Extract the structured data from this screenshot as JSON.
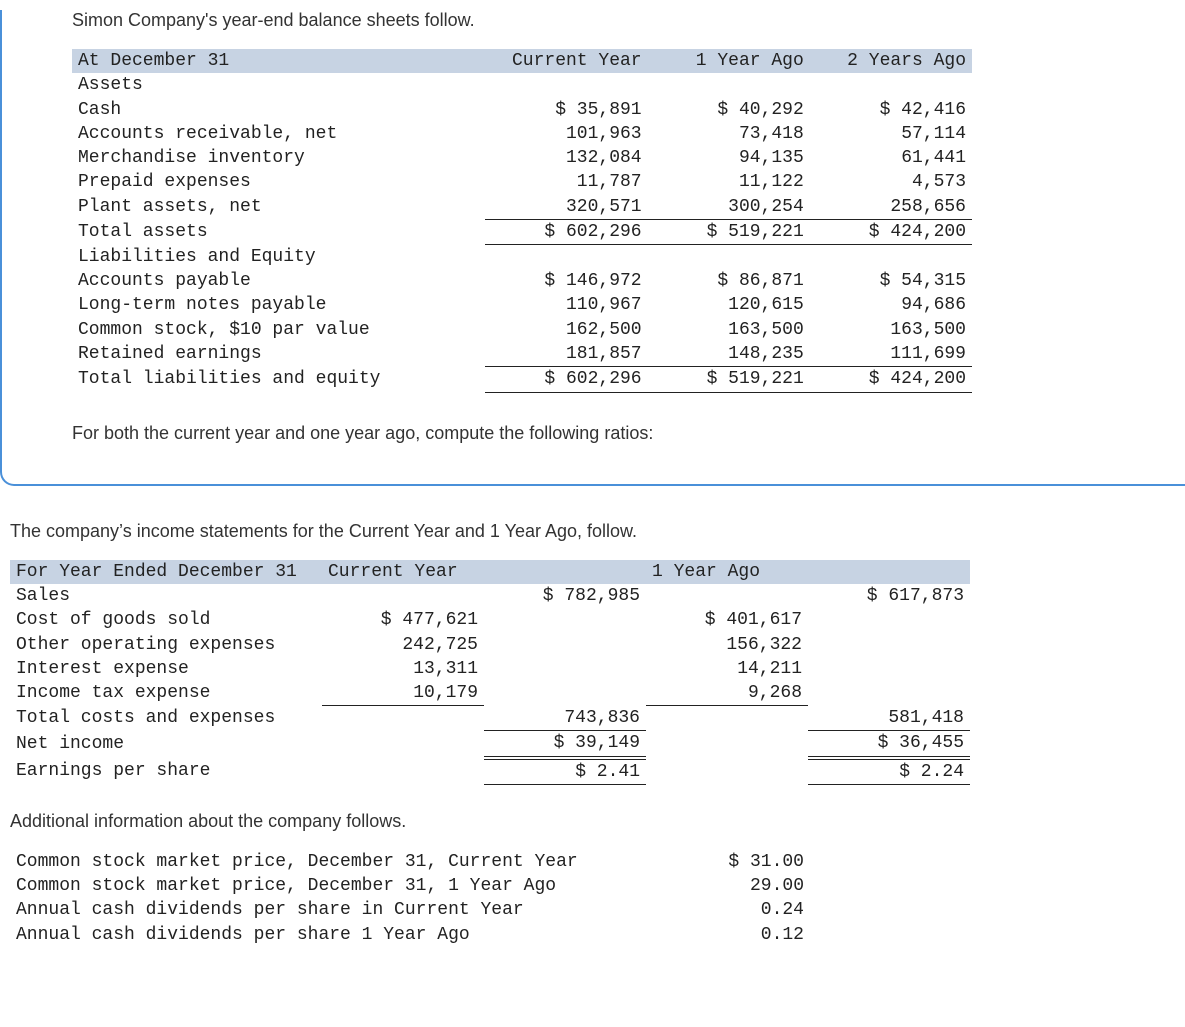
{
  "intro1": "Simon Company's year-end balance sheets follow.",
  "bs": {
    "header": {
      "h0": "At December 31",
      "h1": "Current Year",
      "h2": "1 Year Ago",
      "h3": "2 Years Ago"
    },
    "assets_header": "Assets",
    "rows": {
      "cash": {
        "label": "Cash",
        "c": "$ 35,891",
        "y1": "$ 40,292",
        "y2": "$ 42,416"
      },
      "ar": {
        "label": "Accounts receivable, net",
        "c": "101,963",
        "y1": "73,418",
        "y2": "57,114"
      },
      "inv": {
        "label": "Merchandise inventory",
        "c": "132,084",
        "y1": "94,135",
        "y2": "61,441"
      },
      "prepaid": {
        "label": "Prepaid expenses",
        "c": "11,787",
        "y1": "11,122",
        "y2": "4,573"
      },
      "plant": {
        "label": "Plant assets, net",
        "c": "320,571",
        "y1": "300,254",
        "y2": "258,656"
      },
      "tassets": {
        "label": "Total assets",
        "c": "$ 602,296",
        "y1": "$ 519,221",
        "y2": "$ 424,200"
      }
    },
    "liab_header": "Liabilities and Equity",
    "lrows": {
      "ap": {
        "label": "Accounts payable",
        "c": "$ 146,972",
        "y1": "$ 86,871",
        "y2": "$ 54,315"
      },
      "ltnp": {
        "label": "Long-term notes payable",
        "c": "110,967",
        "y1": "120,615",
        "y2": "94,686"
      },
      "cs": {
        "label": "Common stock, $10 par value",
        "c": "162,500",
        "y1": "163,500",
        "y2": "163,500"
      },
      "re": {
        "label": "Retained earnings",
        "c": "181,857",
        "y1": "148,235",
        "y2": "111,699"
      },
      "tle": {
        "label": "Total liabilities and equity",
        "c": "$ 602,296",
        "y1": "$ 519,221",
        "y2": "$ 424,200"
      }
    }
  },
  "followup1": "For both the current year and one year ago, compute the following ratios:",
  "intro2": "The company’s income statements for the Current Year and 1 Year Ago, follow.",
  "is": {
    "header": {
      "h0": "For Year Ended December 31",
      "h1": "Current Year",
      "h2": "1 Year Ago"
    },
    "rows": {
      "sales": {
        "label": "Sales",
        "c": "$ 782,985",
        "y1": "$ 617,873"
      },
      "cogs": {
        "label": "Cost of goods sold",
        "dc": "$ 477,621",
        "dy1": "$ 401,617"
      },
      "ooe": {
        "label": "Other operating expenses",
        "dc": "242,725",
        "dy1": "156,322"
      },
      "int": {
        "label": "Interest expense",
        "dc": "13,311",
        "dy1": "14,211"
      },
      "tax": {
        "label": "Income tax expense",
        "dc": "10,179",
        "dy1": "9,268"
      },
      "tce": {
        "label": "Total costs and expenses",
        "c": "743,836",
        "y1": "581,418"
      },
      "ni": {
        "label": "Net income",
        "c": "$ 39,149",
        "y1": "$ 36,455"
      },
      "eps": {
        "label": "Earnings per share",
        "c": "$ 2.41",
        "y1": "$ 2.24"
      }
    }
  },
  "intro3": "Additional information about the company follows.",
  "info": {
    "r1": {
      "label": "Common stock market price, December 31, Current Year",
      "v": "$ 31.00"
    },
    "r2": {
      "label": "Common stock market price, December 31, 1 Year Ago",
      "v": "29.00"
    },
    "r3": {
      "label": "Annual cash dividends per share in Current Year",
      "v": "0.24"
    },
    "r4": {
      "label": "Annual cash dividends per share 1 Year Ago",
      "v": "0.12"
    }
  },
  "chart_data": [
    {
      "type": "table",
      "title": "Simon Company year-end balance sheets (At December 31)",
      "columns": [
        "Item",
        "Current Year",
        "1 Year Ago",
        "2 Years Ago"
      ],
      "rows": [
        [
          "Cash",
          35891,
          40292,
          42416
        ],
        [
          "Accounts receivable, net",
          101963,
          73418,
          57114
        ],
        [
          "Merchandise inventory",
          132084,
          94135,
          61441
        ],
        [
          "Prepaid expenses",
          11787,
          11122,
          4573
        ],
        [
          "Plant assets, net",
          320571,
          300254,
          258656
        ],
        [
          "Total assets",
          602296,
          519221,
          424200
        ],
        [
          "Accounts payable",
          146972,
          86871,
          54315
        ],
        [
          "Long-term notes payable",
          110967,
          120615,
          94686
        ],
        [
          "Common stock, $10 par value",
          162500,
          163500,
          163500
        ],
        [
          "Retained earnings",
          181857,
          148235,
          111699
        ],
        [
          "Total liabilities and equity",
          602296,
          519221,
          424200
        ]
      ]
    },
    {
      "type": "table",
      "title": "Income statements (For Year Ended December 31)",
      "columns": [
        "Item",
        "Current Year",
        "1 Year Ago"
      ],
      "rows": [
        [
          "Sales",
          782985,
          617873
        ],
        [
          "Cost of goods sold",
          477621,
          401617
        ],
        [
          "Other operating expenses",
          242725,
          156322
        ],
        [
          "Interest expense",
          13311,
          14211
        ],
        [
          "Income tax expense",
          10179,
          9268
        ],
        [
          "Total costs and expenses",
          743836,
          581418
        ],
        [
          "Net income",
          39149,
          36455
        ],
        [
          "Earnings per share",
          2.41,
          2.24
        ]
      ]
    },
    {
      "type": "table",
      "title": "Additional information",
      "columns": [
        "Item",
        "Value"
      ],
      "rows": [
        [
          "Common stock market price, December 31, Current Year",
          31.0
        ],
        [
          "Common stock market price, December 31, 1 Year Ago",
          29.0
        ],
        [
          "Annual cash dividends per share in Current Year",
          0.24
        ],
        [
          "Annual cash dividends per share 1 Year Ago",
          0.12
        ]
      ]
    }
  ]
}
